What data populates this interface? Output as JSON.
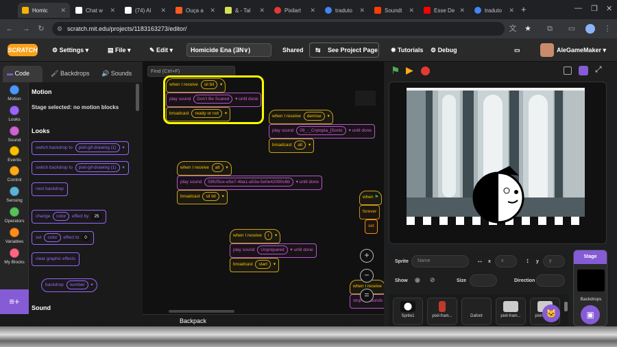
{
  "browser": {
    "tabs": [
      {
        "label": "Homic",
        "color": "#f4b400",
        "active": true
      },
      {
        "label": "Chat w",
        "color": "#ffffff"
      },
      {
        "label": "(74) Al",
        "color": "#ffffff"
      },
      {
        "label": "Ouça a",
        "color": "#ff5a1f"
      },
      {
        "label": "& - Tal",
        "color": "#d4e157"
      },
      {
        "label": "Pixilart",
        "color": "#e53935"
      },
      {
        "label": "traduto",
        "color": "#4285f4"
      },
      {
        "label": "Soundt",
        "color": "#ff3d00"
      },
      {
        "label": "Esse De",
        "color": "#ff0000"
      },
      {
        "label": "traduto",
        "color": "#4285f4"
      }
    ],
    "url": "scratch.mit.edu/projects/1183163273/editor/"
  },
  "menu": {
    "logo": "SCRATCH",
    "settings": "Settings",
    "file": "File",
    "edit": "Edit",
    "project_title": "Homicide Ena (ƎN∨)",
    "shared": "Shared",
    "see_project": "See Project Page",
    "tutorials": "Tutorials",
    "debug": "Debug",
    "user": "AleGameMaker"
  },
  "editor_tabs": {
    "code": "Code",
    "backdrops": "Backdrops",
    "sounds": "Sounds"
  },
  "categories": [
    {
      "label": "Motion",
      "color": "#4c97ff"
    },
    {
      "label": "Looks",
      "color": "#9966ff"
    },
    {
      "label": "Sound",
      "color": "#cf63cf"
    },
    {
      "label": "Events",
      "color": "#ffbf00"
    },
    {
      "label": "Control",
      "color": "#ffab19"
    },
    {
      "label": "Sensing",
      "color": "#5cb1d6"
    },
    {
      "label": "Operators",
      "color": "#59c059"
    },
    {
      "label": "Variables",
      "color": "#ff8c1a"
    },
    {
      "label": "My Blocks",
      "color": "#ff6680"
    }
  ],
  "palette": {
    "motion_title": "Motion",
    "motion_note": "Stage selected: no motion blocks",
    "looks_title": "Looks",
    "switch1": "switch backdrop to",
    "switch1_val": "pixil-gif-drawing (1)",
    "switch2": "switch backdrop to",
    "switch2_val": "pixil-gif-drawing (1)",
    "next_backdrop": "next backdrop",
    "change": "change",
    "change_effect": "color",
    "change_by": "effect by",
    "change_val": "25",
    "set": "set",
    "set_effect": "color",
    "set_to": "effect to",
    "set_val": "0",
    "clear": "clear graphic effects",
    "backdrop": "backdrop",
    "backdrop_val": "number",
    "sound_title": "Sound"
  },
  "code": {
    "search_placeholder": "Find (Ctrl+F)",
    "s1": {
      "hat": "when I receive",
      "hat_val": "sil bil",
      "play": "play sound",
      "sound": "Don't Be Scared",
      "until": "until done",
      "broadcast": "broadcast",
      "msg": "ready or not"
    },
    "s2": {
      "hat": "when I receive",
      "hat_val": "demise",
      "play": "play sound",
      "sound": "09_-_Crytopia_[Sonic",
      "until": "until done",
      "broadcast": "broadcast",
      "msg": "alt"
    },
    "s3": {
      "hat": "when I receive",
      "hat_val": "alt",
      "play": "play sound",
      "sound": "59fcf5ce-e5e7-4ba1-a53a-5e0e42090c6b",
      "until": "until done",
      "broadcast": "broadcast",
      "msg": "sil bil"
    },
    "s4": {
      "hat": "when I receive",
      "hat_val": "i",
      "play": "play sound",
      "sound": "Unprepared",
      "until": "until done",
      "broadcast": "broadcast",
      "msg": "start"
    },
    "s5": {
      "hat": "when",
      "forever": "forever",
      "set": "set"
    },
    "s6": {
      "hat": "when I receive",
      "stop": "stop all sounds"
    },
    "zoom_in": "+",
    "zoom_out": "−",
    "zoom_reset": "=",
    "backpack": "Backpack"
  },
  "sprite_info": {
    "sprite_label": "Sprite",
    "name_placeholder": "Name",
    "x_label": "x",
    "x_placeholder": "x",
    "y_label": "y",
    "y_placeholder": "y",
    "show_label": "Show",
    "size_label": "Size",
    "direction_label": "Direction"
  },
  "sprites": [
    {
      "name": "Sprite1",
      "color": "#ddd"
    },
    {
      "name": "pixil-fram...",
      "color": "#c0392b"
    },
    {
      "name": "Dafont",
      "color": "#222"
    },
    {
      "name": "pixil-fram...",
      "color": "#ccc"
    },
    {
      "name": "pixil-fram...",
      "color": "#ccc"
    }
  ],
  "stage_panel": {
    "title": "Stage",
    "backdrops_label": "Backdrops"
  }
}
